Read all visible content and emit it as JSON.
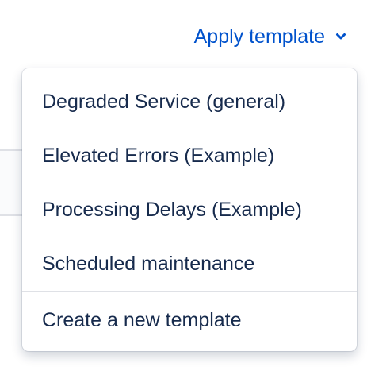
{
  "trigger": {
    "label": "Apply template",
    "icon": "chevron-down-icon",
    "color": "#0052cc"
  },
  "menu": {
    "templates": [
      "Degraded Service (general)",
      "Elevated Errors (Example)",
      "Processing Delays (Example)",
      "Scheduled maintenance"
    ],
    "create_label": "Create a new template"
  },
  "colors": {
    "text": "#172b4d",
    "divider": "#dfe1e6"
  }
}
